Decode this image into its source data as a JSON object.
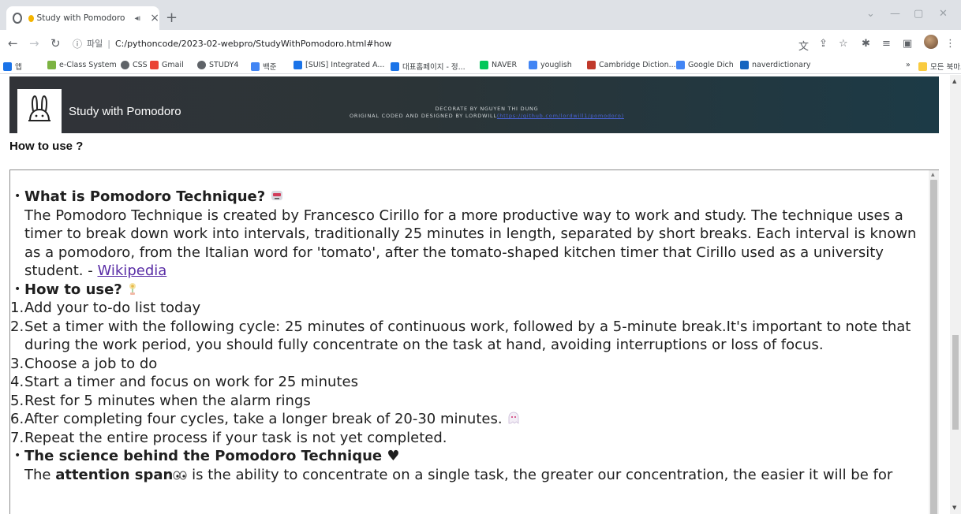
{
  "browser": {
    "tab_title": "Study with Pomodoro",
    "new_tab": "+",
    "address_label": "파일",
    "url": "C:/pythoncode/2023-02-webpro/StudyWithPomodoro.html#how",
    "bookmarks": [
      {
        "label": "앱",
        "icon": "apps-icon",
        "color": "#1a73e8"
      },
      {
        "label": "e-Class System",
        "icon": "eclass-icon",
        "color": "#7cb342"
      },
      {
        "label": "CSS",
        "icon": "globe-icon",
        "color": "#5f6368"
      },
      {
        "label": "Gmail",
        "icon": "gmail-icon",
        "color": "#ea4335"
      },
      {
        "label": "STUDY4",
        "icon": "globe-icon",
        "color": "#5f6368"
      },
      {
        "label": "백준",
        "icon": "code-icon",
        "color": "#4285f4"
      },
      {
        "label": "[SUIS] Integrated A...",
        "icon": "suis-icon",
        "color": "#1a73e8"
      },
      {
        "label": "대표홈페이지 - 정...",
        "icon": "suis-icon",
        "color": "#1a73e8"
      },
      {
        "label": "NAVER",
        "icon": "naver-icon",
        "color": "#03c75a"
      },
      {
        "label": "youglish",
        "icon": "youglish-icon",
        "color": "#4285f4"
      },
      {
        "label": "Cambridge Diction...",
        "icon": "cambridge-icon",
        "color": "#c0392b"
      },
      {
        "label": "Google Dich",
        "icon": "translate-icon",
        "color": "#4285f4"
      },
      {
        "label": "naverdictionary",
        "icon": "dict-icon",
        "color": "#1565c0"
      }
    ],
    "more_bookmarks": "»",
    "all_bookmarks": "모든 북마크"
  },
  "header": {
    "app_title": "Study with Pomodoro",
    "credit_line1": "DECORATE BY NGUYEN THI DUNG",
    "credit_line2": "ORIGINAL CODED AND DESIGNED BY LORDWILL",
    "credit_link": "(https://github.com/lordwill1/pomodoro)"
  },
  "section": {
    "title": "How to use ?"
  },
  "content": {
    "what_heading": "What is Pomodoro Technique?",
    "what_text": "The Pomodoro Technique is created by Francesco Cirillo for a more productive way to work and study. The technique uses a timer to break down work into intervals, traditionally 25 minutes in length, separated by short breaks. Each interval is known as a pomodoro, from the Italian word for 'tomato', after the tomato-shaped kitchen timer that Cirillo used as a university student. - ",
    "what_link": "Wikipedia",
    "how_heading": "How to use?",
    "steps": [
      {
        "num": "1.",
        "text": "Add your to-do list today"
      },
      {
        "num": "2.",
        "text": "Set a timer with the following cycle: 25 minutes of continuous work, followed by a 5-minute break.It's important to note that during the work period, you should fully concentrate on the task at hand, avoiding interruptions or loss of focus."
      },
      {
        "num": "3.",
        "text": "Choose a job to do"
      },
      {
        "num": "4.",
        "text": "Start a timer and focus on work for 25 minutes"
      },
      {
        "num": "5.",
        "text": "Rest for 5 minutes when the alarm rings"
      },
      {
        "num": "6.",
        "text": "After completing four cycles, take a longer break of 20-30 minutes."
      },
      {
        "num": "7.",
        "text": "Repeat the entire process if your task is not yet completed."
      }
    ],
    "science_heading": "The science behind the Pomodoro Technique ♥",
    "science_prefix": "The ",
    "science_bold": "attention span",
    "science_text": " is the ability to concentrate on a single task, the greater our concentration, the easier it will be for"
  }
}
